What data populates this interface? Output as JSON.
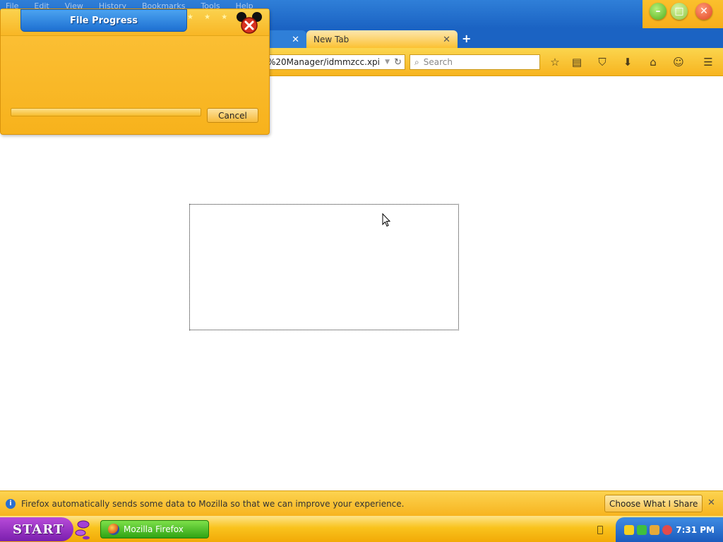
{
  "menubar": {
    "items": [
      "File",
      "Edit",
      "View",
      "History",
      "Bookmarks",
      "Tools",
      "Help"
    ]
  },
  "tabs": [
    {
      "label": "",
      "active": false
    },
    {
      "label": "New Tab",
      "active": true
    }
  ],
  "navbar": {
    "url": "%20Manager/idmmzcc.xpi",
    "search_placeholder": "Search",
    "icons": [
      "bookmark-star-icon",
      "reading-list-icon",
      "pocket-icon",
      "downloads-icon",
      "home-icon",
      "hello-icon",
      "menu-icon"
    ]
  },
  "dialog": {
    "title": "File Progress",
    "cancel_label": "Cancel",
    "progress": 0
  },
  "notification": {
    "text": "Firefox automatically sends some data to Mozilla so that we can improve your experience.",
    "button_label": "Choose What I Share"
  },
  "taskbar": {
    "start_label": "START",
    "task_label": "Mozilla Firefox",
    "clock": "7:31 PM"
  },
  "colors": {
    "theme_yellow": "#f7b41f",
    "theme_blue": "#1b63c3",
    "start_purple": "#9b35c8",
    "task_green": "#3fbf1e"
  }
}
